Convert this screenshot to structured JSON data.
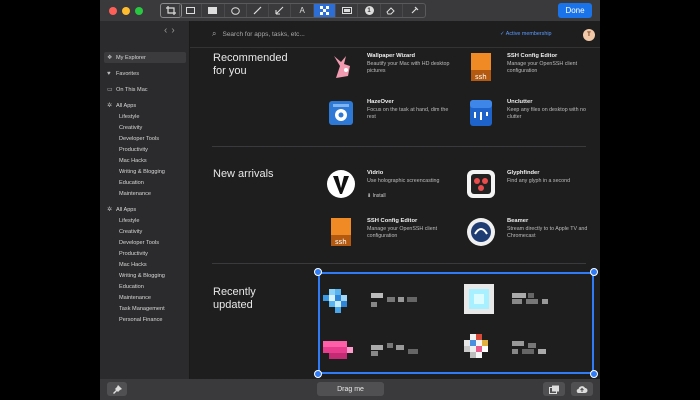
{
  "toolbar": {
    "done_label": "Done",
    "tools": [
      "crop-icon",
      "rectangle-icon",
      "filled-rectangle-icon",
      "ellipse-icon",
      "pencil-icon",
      "arrow-icon",
      "text-icon",
      "pixelate-icon",
      "highlight-icon",
      "counter-icon",
      "eraser-icon",
      "color-icon"
    ],
    "counter_label": "1",
    "text_tool_label": "A"
  },
  "search": {
    "placeholder": "Search for apps, tasks, etc..."
  },
  "header": {
    "membership": "Active membership",
    "avatar_initial": "T"
  },
  "sidebar": {
    "top_items": [
      {
        "label": "My Explorer",
        "icon": "compass-icon"
      },
      {
        "label": "Favorites",
        "icon": "heart-icon"
      },
      {
        "label": "On This Mac",
        "icon": "computer-icon"
      }
    ],
    "group1": {
      "label": "All Apps",
      "items": [
        "Lifestyle",
        "Creativity",
        "Developer Tools",
        "Productivity",
        "Mac Hacks",
        "Writing & Blogging",
        "Education",
        "Maintenance"
      ]
    },
    "group2": {
      "label": "All Apps",
      "items": [
        "Lifestyle",
        "Creativity",
        "Developer Tools",
        "Productivity",
        "Mac Hacks",
        "Writing & Blogging",
        "Education",
        "Maintenance",
        "Task Management",
        "Personal Finance"
      ]
    }
  },
  "sections": {
    "recommended": {
      "title_line1": "Recommended",
      "title_line2": "for you",
      "apps": [
        {
          "name": "Wallpaper Wizard",
          "desc": "Beautify your Mac with HD desktop pictures"
        },
        {
          "name": "SSH Config Editor",
          "desc": "Manage your OpenSSH client configuration"
        },
        {
          "name": "HazeOver",
          "desc": "Focus on the task at hand, dim the rest"
        },
        {
          "name": "Unclutter",
          "desc": "Keep any files on desktop with no clutter"
        }
      ]
    },
    "new_arrivals": {
      "title": "New arrivals",
      "apps": [
        {
          "name": "Vidrio",
          "desc": "Use holographic screencasting",
          "extra": "Install"
        },
        {
          "name": "Glyphfinder",
          "desc": "Find any glyph in a second"
        },
        {
          "name": "SSH Config Editor",
          "desc": "Manage your OpenSSH client configuration"
        },
        {
          "name": "Beamer",
          "desc": "Stream directly to to Apple TV and Chromecast"
        }
      ]
    },
    "recently_updated": {
      "title_line1": "Recently",
      "title_line2": "updated"
    }
  },
  "bottombar": {
    "drag_label": "Drag me"
  },
  "colors": {
    "accent": "#2f7cf6",
    "done": "#1a73e8",
    "membership": "#5b9cff"
  }
}
